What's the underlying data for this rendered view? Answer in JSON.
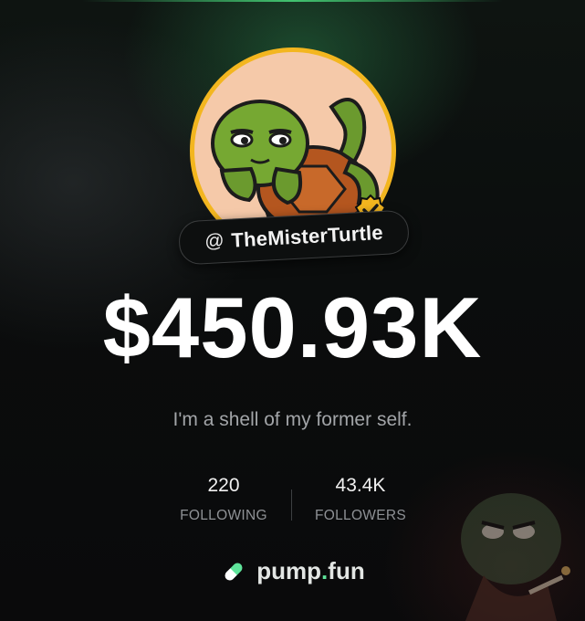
{
  "profile": {
    "handle_prefix": "@",
    "username": "TheMisterTurtle",
    "avatar_icon": "turtle-avatar",
    "verified_icon": "verified-check-icon"
  },
  "market_cap": "$450.93K",
  "bio": "I'm a shell of my former self.",
  "stats": {
    "following": {
      "value": "220",
      "label": "FOLLOWING"
    },
    "followers": {
      "value": "43.4K",
      "label": "FOLLOWERS"
    }
  },
  "brand": {
    "icon": "pill-icon",
    "name_part1": "pump",
    "dot": ".",
    "name_part2": "fun"
  },
  "colors": {
    "accent_green": "#5fe39a",
    "avatar_ring": "#f3b61f",
    "avatar_bg": "#f5c9a9"
  }
}
